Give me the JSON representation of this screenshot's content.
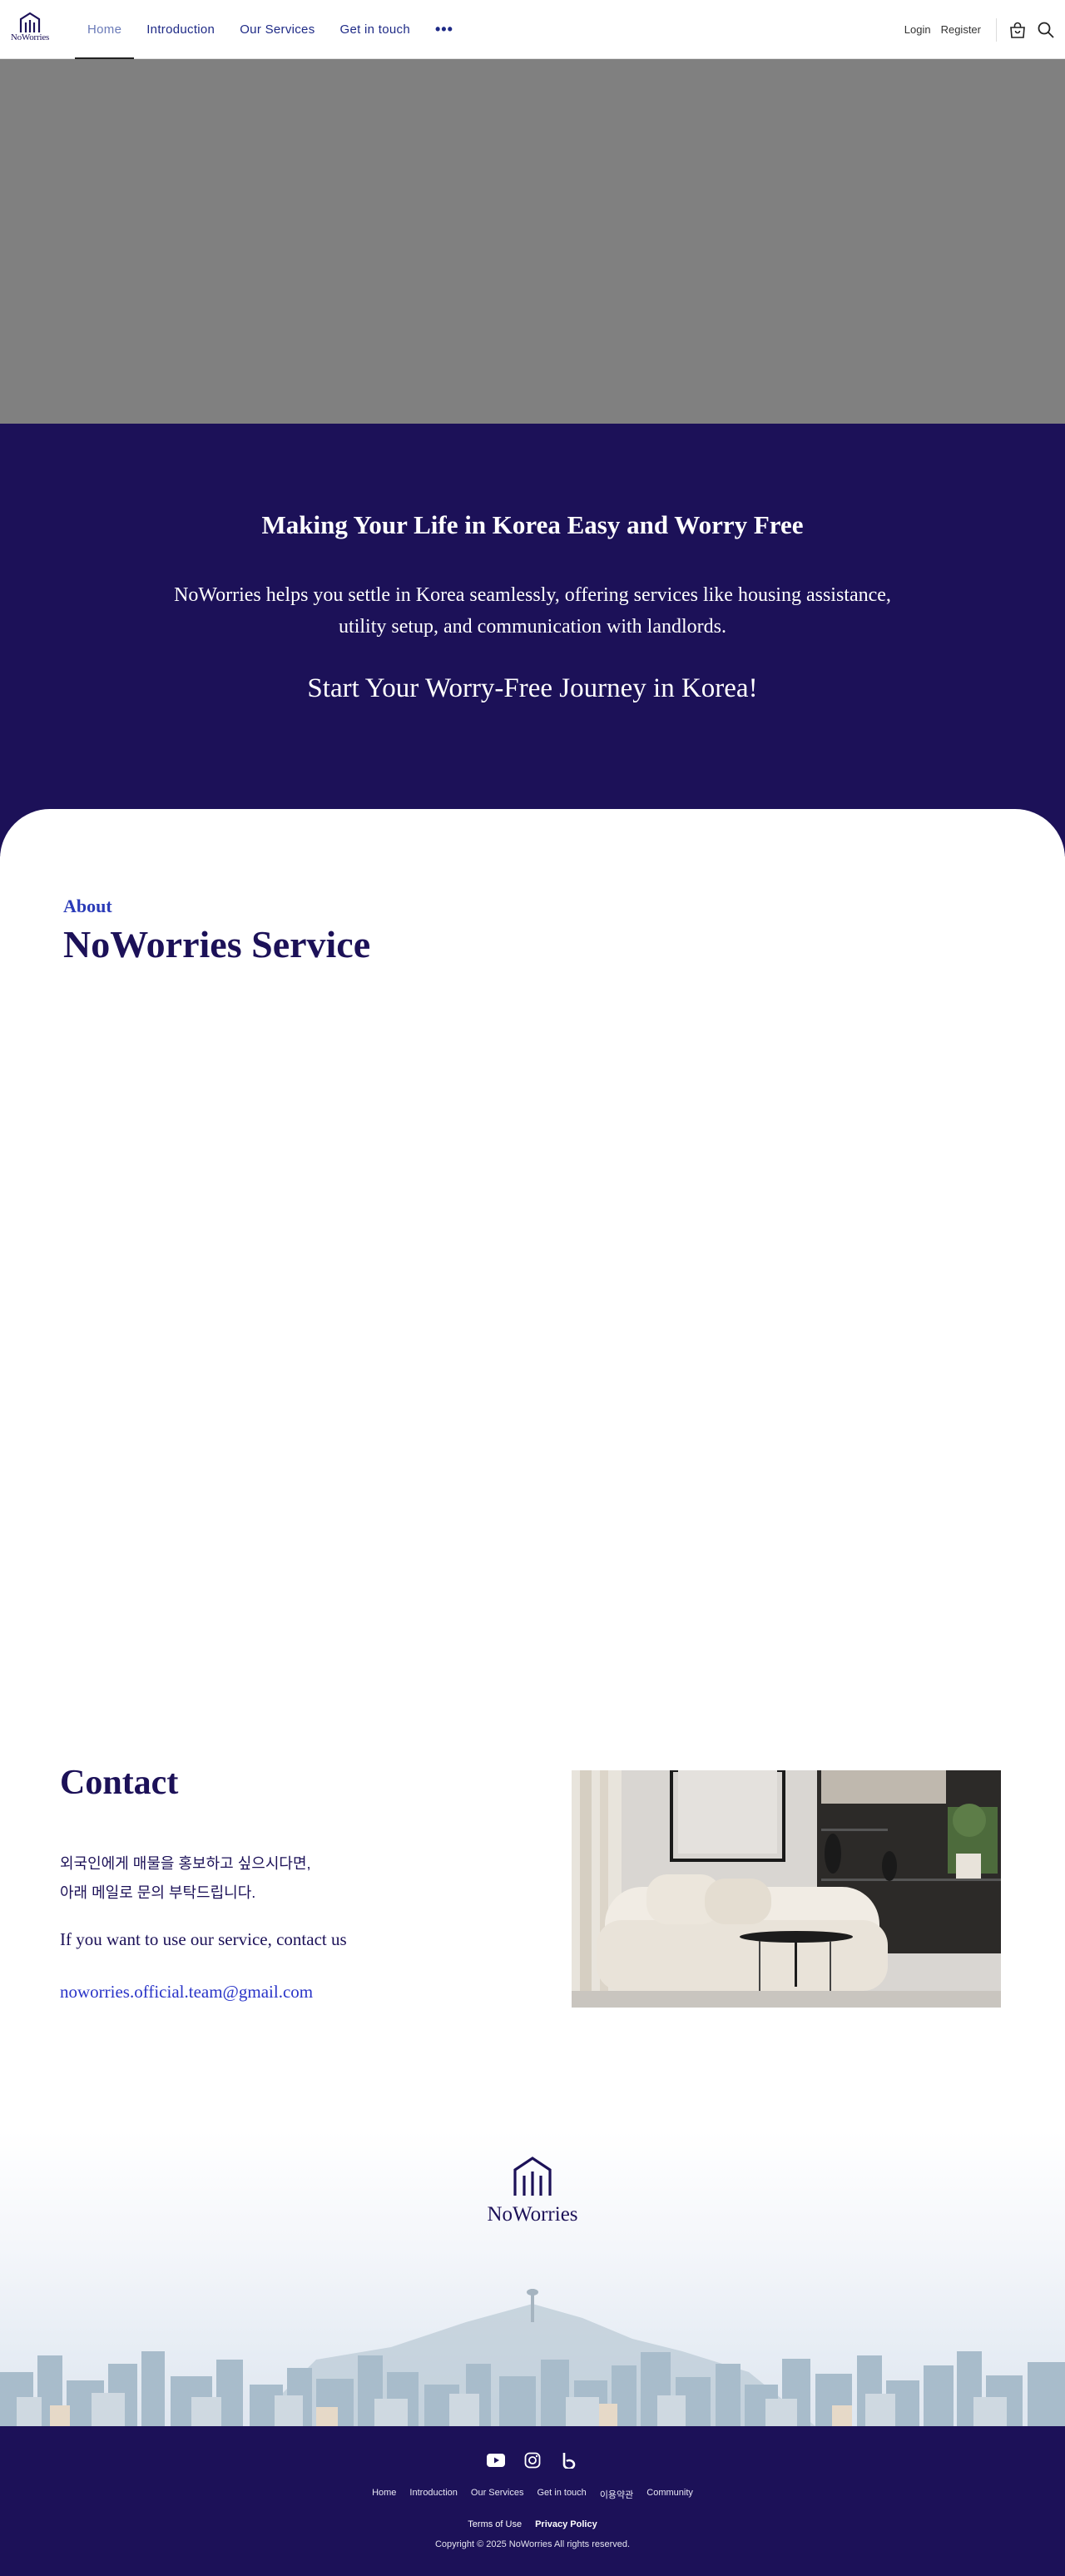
{
  "header": {
    "logo_text": "NoWorries",
    "nav": [
      {
        "label": "Home",
        "active": true
      },
      {
        "label": "Introduction"
      },
      {
        "label": "Our Services"
      },
      {
        "label": "Get in touch"
      }
    ],
    "more_label": "•••",
    "login": "Login",
    "register": "Register",
    "icons": [
      "shopping-bag-icon",
      "search-icon"
    ]
  },
  "hero": {
    "image_color": "#808080"
  },
  "intro": {
    "title": "Making Your Life in Korea Easy and Worry Free",
    "description": "NoWorries helps you settle in Korea seamlessly, offering services like housing assistance, utility setup, and communication with landlords.",
    "cta": "Start Your Worry-Free Journey in Korea!",
    "background": "#1c1158"
  },
  "about": {
    "kicker": "About",
    "title": "NoWorries Service"
  },
  "contact": {
    "title": "Contact",
    "korean_line1": "외국인에게 매물을 홍보하고 싶으시다면,",
    "korean_line2": "아래 메일로 문의 부탁드립니다.",
    "english": "If you want to use our service, contact us",
    "email": "noworries.official.team@gmail.com"
  },
  "footer_banner": {
    "logo_text": "NoWorries"
  },
  "footer": {
    "social": [
      "youtube-icon",
      "instagram-icon",
      "blog-icon"
    ],
    "nav": [
      "Home",
      "Introduction",
      "Our Services",
      "Get in touch",
      "이용약관",
      "Community"
    ],
    "terms": "Terms of Use",
    "privacy": "Privacy Policy",
    "copyright": "Copyright © 2025 NoWorries All rights reserved."
  },
  "colors": {
    "brand_navy": "#1c1158",
    "link_blue": "#2a35c8",
    "nav_blue": "#1e2a86"
  }
}
